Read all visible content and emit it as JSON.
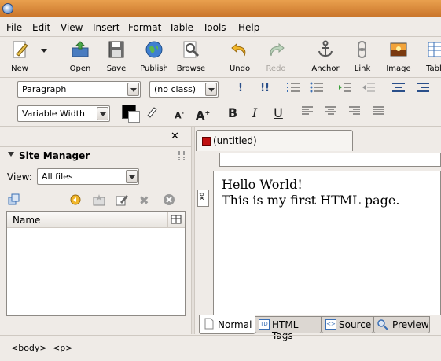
{
  "menu": [
    "File",
    "Edit",
    "View",
    "Insert",
    "Format",
    "Table",
    "Tools",
    "Help"
  ],
  "toolbar": {
    "new": "New",
    "open": "Open",
    "save": "Save",
    "publish": "Publish",
    "browse": "Browse",
    "undo": "Undo",
    "redo": "Redo",
    "anchor": "Anchor",
    "link": "Link",
    "image": "Image",
    "table": "Table"
  },
  "format_bar": {
    "paragraph": "Paragraph",
    "class": "(no class)",
    "font": "Variable Width",
    "bold": "B",
    "italic": "I",
    "underline": "U",
    "text_color": "#000000"
  },
  "sidebar": {
    "title": "Site Manager",
    "view_label": "View:",
    "view_value": "All files",
    "column_name": "Name"
  },
  "editor": {
    "tab_title": "(untitled)",
    "ruler_unit": "px",
    "lines": [
      "Hello World!",
      "This is my first HTML page."
    ]
  },
  "mode_tabs": {
    "normal": "Normal",
    "html_tags": "HTML Tags",
    "source": "Source",
    "preview": "Preview"
  },
  "status": {
    "tag1": "<body>",
    "tag2": "<p>"
  },
  "colors": {
    "title_bar": "#d48437",
    "background": "#efebe7",
    "accent_blue": "#3a6fb5"
  }
}
